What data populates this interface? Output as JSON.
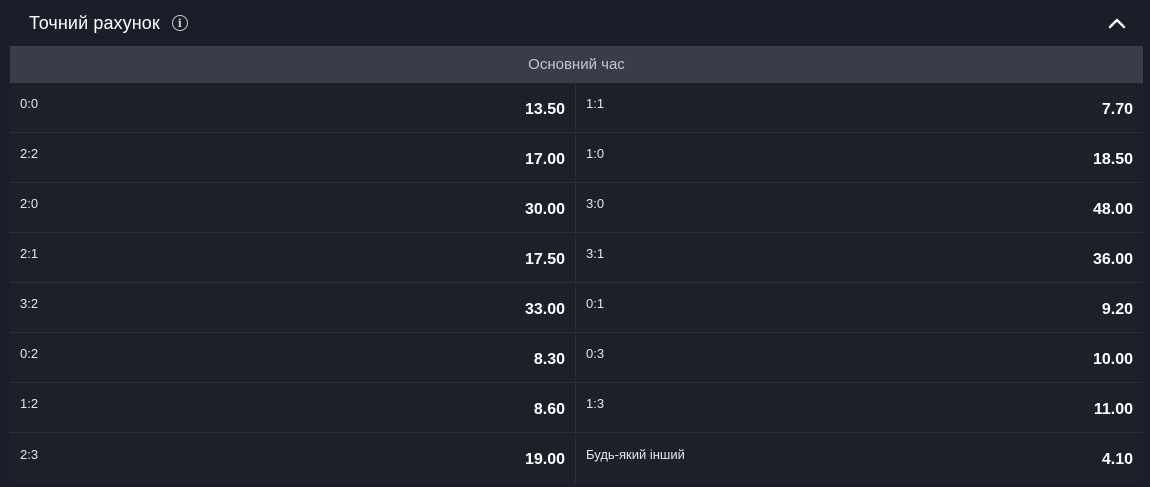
{
  "header": {
    "title": "Точний рахунок",
    "info_icon": "info-icon",
    "collapse_icon": "chevron-up-icon"
  },
  "period": {
    "label": "Основний час"
  },
  "rows": [
    {
      "left": {
        "score": "0:0",
        "odds": "13.50"
      },
      "right": {
        "score": "1:1",
        "odds": "7.70"
      }
    },
    {
      "left": {
        "score": "2:2",
        "odds": "17.00"
      },
      "right": {
        "score": "1:0",
        "odds": "18.50"
      }
    },
    {
      "left": {
        "score": "2:0",
        "odds": "30.00"
      },
      "right": {
        "score": "3:0",
        "odds": "48.00"
      }
    },
    {
      "left": {
        "score": "2:1",
        "odds": "17.50"
      },
      "right": {
        "score": "3:1",
        "odds": "36.00"
      }
    },
    {
      "left": {
        "score": "3:2",
        "odds": "33.00"
      },
      "right": {
        "score": "0:1",
        "odds": "9.20"
      }
    },
    {
      "left": {
        "score": "0:2",
        "odds": "8.30"
      },
      "right": {
        "score": "0:3",
        "odds": "10.00"
      }
    },
    {
      "left": {
        "score": "1:2",
        "odds": "8.60"
      },
      "right": {
        "score": "1:3",
        "odds": "11.00"
      }
    },
    {
      "left": {
        "score": "2:3",
        "odds": "19.00"
      },
      "right": {
        "score": "Будь-який інший",
        "odds": "4.10"
      }
    }
  ]
}
